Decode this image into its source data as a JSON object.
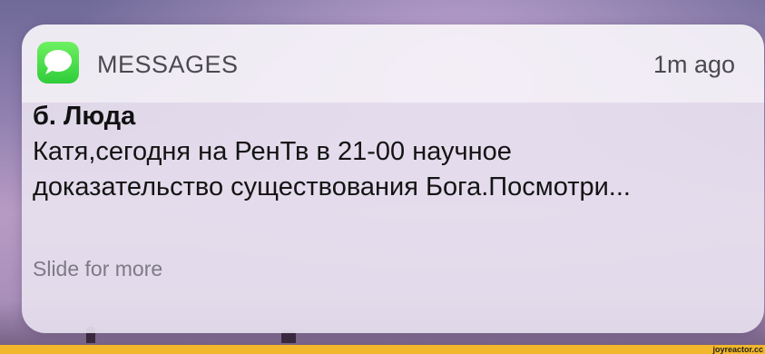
{
  "notification": {
    "app_icon": "messages-app-icon",
    "app_name": "MESSAGES",
    "time": "1m ago",
    "sender": "б. Люда",
    "message": "Катя,сегодня на РенТв в 21-00 научное доказательство существования Бога.Посмотри...",
    "hint": "Slide for more"
  },
  "watermark": "joyreactor.cc",
  "colors": {
    "accent_green": "#2fcc3a",
    "bottom_bar": "#f3b72b"
  }
}
